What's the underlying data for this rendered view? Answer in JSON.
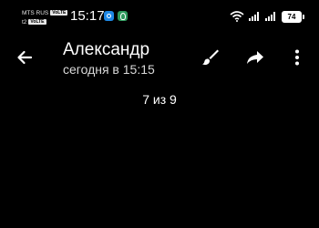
{
  "status_bar": {
    "carrier1": "MTS RUS",
    "carrier1_badge": "VoLTE",
    "carrier2": "t2",
    "carrier2_badge": "VoLTE",
    "time": "15:17",
    "battery": "74",
    "notification_icons": [
      "vpn-icon",
      "app-notification-icon"
    ],
    "system_icons": [
      "wifi-icon",
      "signal-icon",
      "signal-icon",
      "battery-icon"
    ]
  },
  "toolbar": {
    "contact_name": "Александр",
    "timestamp": "сегодня в 15:15",
    "icons": [
      "back-arrow-icon",
      "brush-icon",
      "share-icon",
      "more-vert-icon"
    ]
  },
  "viewer": {
    "counter": "7 из 9"
  },
  "colors": {
    "background": "#000000",
    "foreground": "#ffffff",
    "secondary_text": "#d8d8d8"
  }
}
